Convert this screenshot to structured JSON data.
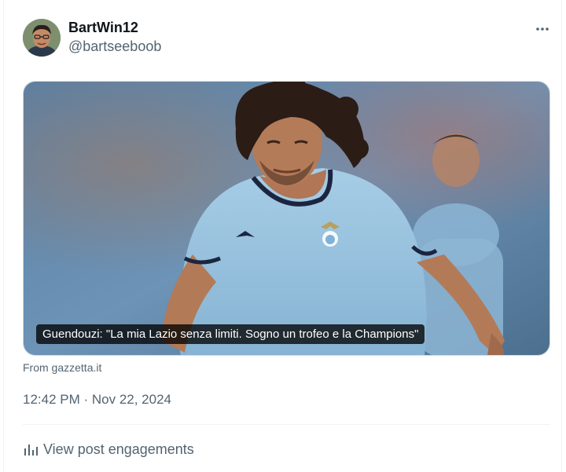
{
  "post": {
    "author": {
      "display_name": "BartWin12",
      "handle": "@bartseeboob",
      "avatar_icon": "avatar-photo"
    },
    "more_icon": "more-horizontal-icon",
    "media": {
      "caption": "Guendouzi: \"La mia Lazio senza limiti. Sogno un trofeo e la Champions\"",
      "source": "From gazzetta.it"
    },
    "timestamp": "12:42 PM · Nov 22, 2024",
    "engagements": {
      "icon": "analytics-icon",
      "label": "View post engagements"
    }
  },
  "colors": {
    "text_primary": "#0f1419",
    "text_secondary": "#536471",
    "border": "#eff3f4",
    "caption_bg": "#000000"
  }
}
